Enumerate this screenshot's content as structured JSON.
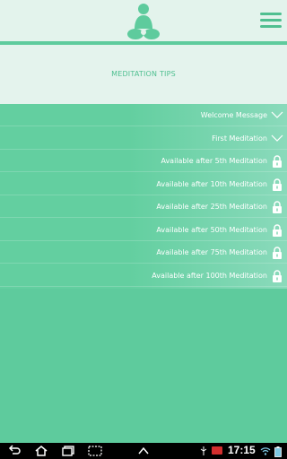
{
  "header": {
    "title": "MEDITATION TIPS"
  },
  "tips": [
    {
      "label": "Welcome Message",
      "icon": "chevron-down-icon",
      "locked": false
    },
    {
      "label": "First Meditation",
      "icon": "chevron-down-icon",
      "locked": false
    },
    {
      "label": "Available after 5th Meditation",
      "icon": "lock-icon",
      "locked": true
    },
    {
      "label": "Available after 10th Meditation",
      "icon": "lock-icon",
      "locked": true
    },
    {
      "label": "Available after 25th Meditation",
      "icon": "lock-icon",
      "locked": true
    },
    {
      "label": "Available after 50th Meditation",
      "icon": "lock-icon",
      "locked": true
    },
    {
      "label": "Available after 75th Meditation",
      "icon": "lock-icon",
      "locked": true
    },
    {
      "label": "Available after 100th Meditation",
      "icon": "lock-icon",
      "locked": true
    }
  ],
  "navbar": {
    "time": "17:15"
  },
  "colors": {
    "accent": "#5ecb9d",
    "header_bg": "#e3f3ec",
    "title_text": "#4fbf90"
  }
}
